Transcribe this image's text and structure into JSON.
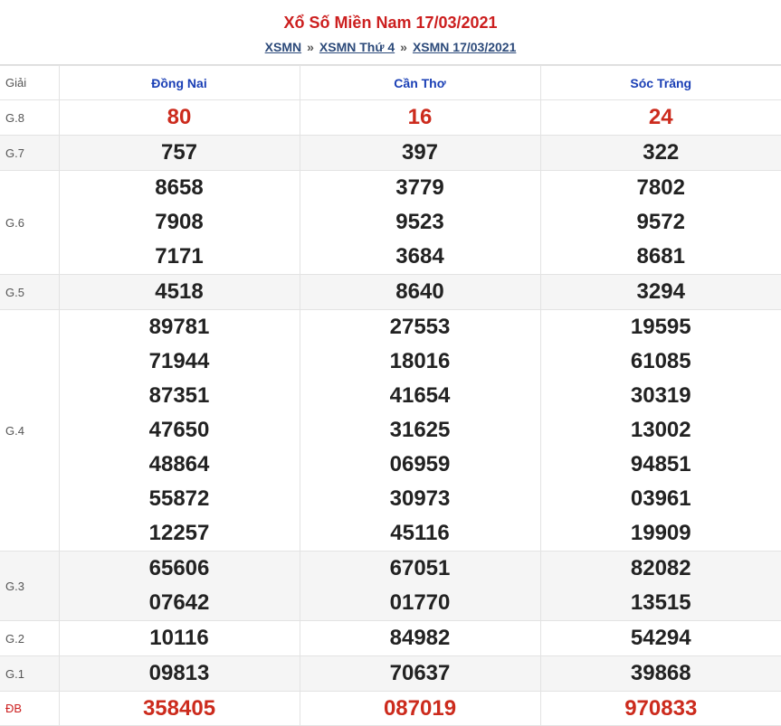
{
  "header": {
    "title": "Xổ Số Miền Nam 17/03/2021",
    "breadcrumb": [
      "XSMN",
      "XSMN Thứ 4",
      "XSMN 17/03/2021"
    ],
    "separator": "»"
  },
  "table": {
    "prize_header": "Giải",
    "provinces": [
      "Đồng Nai",
      "Cần Thơ",
      "Sóc Trăng"
    ],
    "rows": [
      {
        "label": "G.8",
        "values": [
          [
            "80"
          ],
          [
            "16"
          ],
          [
            "24"
          ]
        ]
      },
      {
        "label": "G.7",
        "values": [
          [
            "757"
          ],
          [
            "397"
          ],
          [
            "322"
          ]
        ]
      },
      {
        "label": "G.6",
        "values": [
          [
            "8658",
            "7908",
            "7171"
          ],
          [
            "3779",
            "9523",
            "3684"
          ],
          [
            "7802",
            "9572",
            "8681"
          ]
        ]
      },
      {
        "label": "G.5",
        "values": [
          [
            "4518"
          ],
          [
            "8640"
          ],
          [
            "3294"
          ]
        ]
      },
      {
        "label": "G.4",
        "values": [
          [
            "89781",
            "71944",
            "87351",
            "47650",
            "48864",
            "55872",
            "12257"
          ],
          [
            "27553",
            "18016",
            "41654",
            "31625",
            "06959",
            "30973",
            "45116"
          ],
          [
            "19595",
            "61085",
            "30319",
            "13002",
            "94851",
            "03961",
            "19909"
          ]
        ]
      },
      {
        "label": "G.3",
        "values": [
          [
            "65606",
            "07642"
          ],
          [
            "67051",
            "01770"
          ],
          [
            "82082",
            "13515"
          ]
        ]
      },
      {
        "label": "G.2",
        "values": [
          [
            "10116"
          ],
          [
            "84982"
          ],
          [
            "54294"
          ]
        ]
      },
      {
        "label": "G.1",
        "values": [
          [
            "09813"
          ],
          [
            "70637"
          ],
          [
            "39868"
          ]
        ]
      },
      {
        "label": "ĐB",
        "values": [
          [
            "358405"
          ],
          [
            "087019"
          ],
          [
            "970833"
          ]
        ]
      }
    ]
  },
  "colors": {
    "title": "#cc1f1f",
    "link": "#2c4a7a",
    "province": "#1a3fb5",
    "highlight_number": "#cc2b1d",
    "alt_row": "#f5f5f5"
  }
}
